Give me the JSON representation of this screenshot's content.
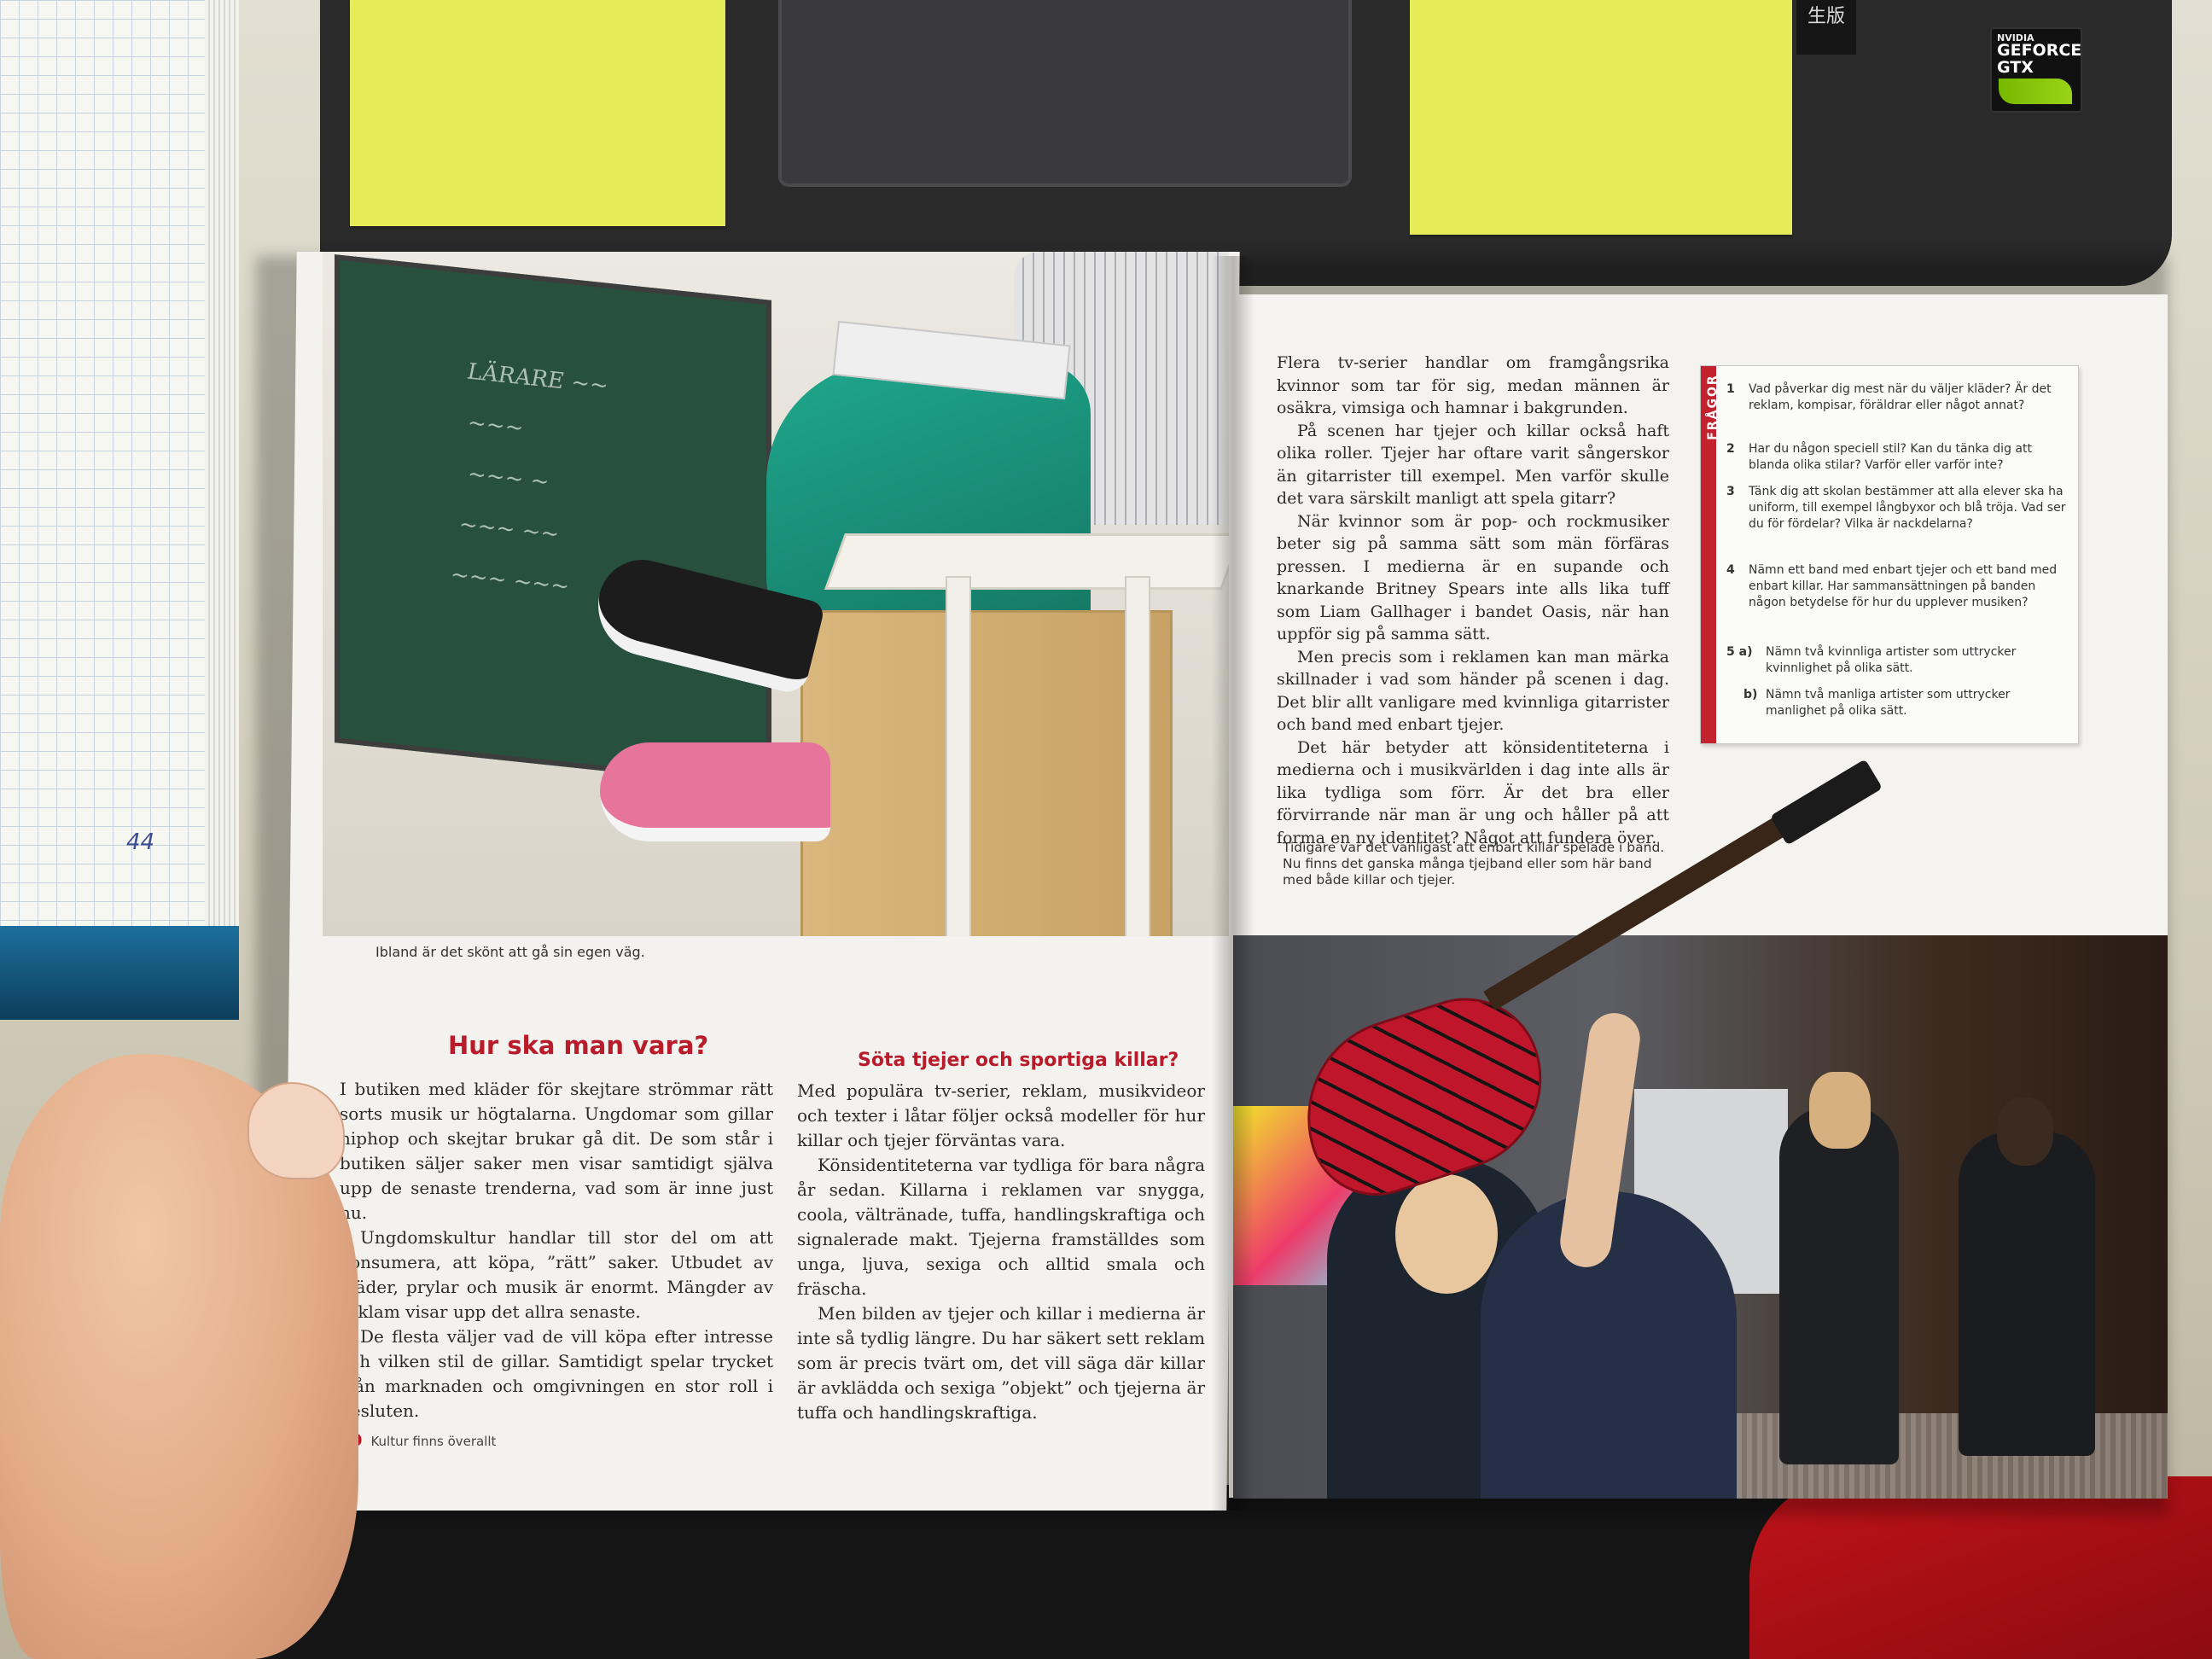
{
  "notebook": {
    "page_number": "44"
  },
  "laptop": {
    "sticker_text": "生版",
    "nvidia_badge": {
      "brand": "NVIDIA",
      "line1": "GEFORCE",
      "line2": "GTX"
    }
  },
  "left_page": {
    "photo_caption": "Ibland är det skönt att gå sin egen väg.",
    "section1": {
      "heading": "Hur ska man vara?",
      "paragraphs": [
        "I butiken med kläder för skejtare strömmar rätt sorts musik ur högtalarna. Ungdomar som gillar hiphop och skejtar brukar gå dit. De som står i butiken säljer saker men visar samtidigt själva upp de senaste trenderna, vad som är inne just nu.",
        "Ungdomskultur handlar till stor del om att konsumera, att köpa, ”rätt” saker. Utbudet av kläder, prylar och musik är enormt. Mängder av reklam visar upp det allra senaste.",
        "De flesta väljer vad de vill köpa efter intresse och vilken stil de gillar. Samtidigt spelar trycket från marknaden och omgivningen en stor roll i besluten."
      ]
    },
    "section2": {
      "heading": "Söta tjejer och sportiga killar?",
      "paragraphs": [
        "Med populära tv-serier, reklam, musikvideor och texter i låtar följer också modeller för hur killar och tjejer förväntas vara.",
        "Könsidentiteterna var tydliga för bara några år sedan. Killarna i reklamen var snygga, coola, vältränade, tuffa, handlingskraftiga och signalerade makt. Tjejerna framställdes som unga, ljuva, sexiga och alltid smala och fräscha.",
        "Men bilden av tjejer och killar i medierna är inte så tydlig längre. Du har säkert sett reklam som är precis tvärt om, det vill säga där killar är avklädda och sexiga ”objekt” och tjejerna är tuffa och handlingskraftiga."
      ]
    },
    "folio": {
      "page": "20",
      "title": "Kultur finns överallt"
    }
  },
  "right_page": {
    "paragraphs": [
      "Flera tv-serier handlar om framgångsrika kvinnor som tar för sig, medan männen är osäkra, vimsiga och hamnar i bakgrunden.",
      "På scenen har tjejer och killar också haft olika roller. Tjejer har oftare varit sångerskor än gitarrister till exempel. Men varför skulle det vara särskilt manligt att spela gitarr?",
      "När kvinnor som är pop- och rockmusiker beter sig på samma sätt som män förfäras pressen. I medierna är en supande och knarkande Britney Spears inte alls lika tuff som Liam Gallhager i bandet Oasis, när han uppför sig på samma sätt.",
      "Men precis som i reklamen kan man märka skillnader i vad som händer på scenen i dag. Det blir allt vanligare med kvinnliga gitarrister och band med enbart tjejer.",
      "Det här betyder att könsidentiteterna i medierna och i musikvärlden i dag inte alls är lika tydliga som förr. Är det bra eller förvirrande när man är ung och håller på att forma en ny identitet? Något att fundera över."
    ],
    "photo_caption": "Tidigare var det vanligast att enbart killar spelade i band. Nu finns det ganska många tjejband eller som här band med både killar och tjejer.",
    "questions": {
      "label": "FRÅGOR",
      "items": [
        {
          "n": "1",
          "text": "Vad påverkar dig mest när du väljer kläder? Är det reklam, kompisar, föräldrar eller något annat?"
        },
        {
          "n": "2",
          "text": "Har du någon speciell stil? Kan du tänka dig att blanda olika stilar? Varför eller varför inte?"
        },
        {
          "n": "3",
          "text": "Tänk dig att skolan bestämmer att alla elever ska ha uniform, till exempel långbyxor och blå tröja. Vad ser du för fördelar? Vilka är nackdelarna?"
        },
        {
          "n": "4",
          "text": "Nämn ett band med enbart tjejer och ett band med enbart killar. Har sammansättningen på banden någon betydelse för hur du upplever musiken?"
        },
        {
          "n": "5 a)",
          "text": "Nämn två kvinnliga artister som uttrycker kvinnlighet på olika sätt."
        },
        {
          "n": "b)",
          "text": "Nämn två manliga artister som uttrycker manlighet på olika sätt."
        }
      ]
    }
  }
}
